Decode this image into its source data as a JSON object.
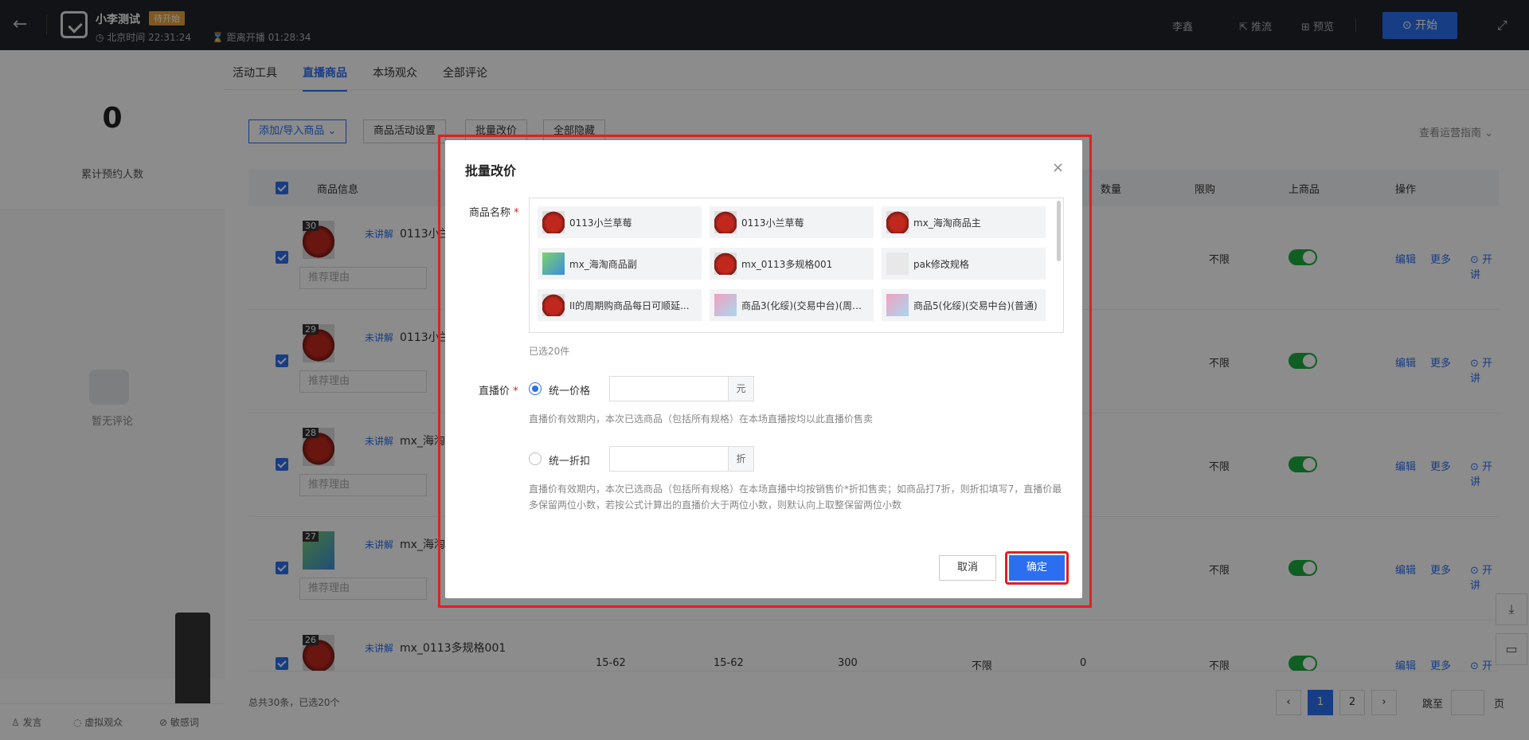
{
  "header": {
    "title": "小李测试",
    "status": "待开始",
    "beijing_time": "北京时间 22:31:24",
    "countdown": "距离开播 01:28:34",
    "user": "李鑫",
    "push_label": "推流",
    "preview_label": "预览",
    "start_label": "开始"
  },
  "left": {
    "reserve_count": "0",
    "reserve_label": "累计预约人数",
    "no_comment": "暂无评论",
    "footer": [
      "发言",
      "虚拟观众",
      "敏感词"
    ]
  },
  "tabs": [
    "活动工具",
    "直播商品",
    "本场观众",
    "全部评论"
  ],
  "toolbar": {
    "add_import": "添加/导入商品 ⌄",
    "activity_settings": "商品活动设置",
    "batch_price": "批量改价",
    "hide_all": "全部隐藏",
    "guide": "查看运营指南 ⌄"
  },
  "table": {
    "headers": {
      "info": "商品信息",
      "sold": "数量",
      "limit": "限购",
      "onsale": "上商品",
      "ops": "操作"
    },
    "rows": [
      {
        "rank": "30",
        "status": "未讲解",
        "name": "0113小兰",
        "reason_placeholder": "推荐理由",
        "limit": "不限"
      },
      {
        "rank": "29",
        "status": "未讲解",
        "name": "0113小兰",
        "reason_placeholder": "推荐理由",
        "limit": "不限"
      },
      {
        "rank": "28",
        "status": "未讲解",
        "name": "mx_海淘",
        "reason_placeholder": "推荐理由",
        "limit": "不限"
      },
      {
        "rank": "27",
        "status": "未讲解",
        "name": "mx_海淘",
        "reason_placeholder": "推荐理由",
        "limit": "不限"
      },
      {
        "rank": "26",
        "status": "未讲解",
        "name": "mx_0113多规格001",
        "reason_placeholder": "",
        "limit": "不限"
      }
    ],
    "last_row_values": [
      "15-62",
      "15-62",
      "300",
      "不限",
      "0"
    ],
    "ops": {
      "edit": "编辑",
      "more": "更多",
      "explain": "开讲"
    }
  },
  "pager": {
    "summary": "总共30条，已选20个",
    "pages": [
      "1",
      "2"
    ],
    "jump_label": "跳至",
    "jump_unit": "页"
  },
  "dialog": {
    "title": "批量改价",
    "close": "×",
    "product_label": "商品名称",
    "products": [
      "0113小兰草莓",
      "0113小兰草莓",
      "mx_海淘商品主",
      "mx_海淘商品副",
      "mx_0113多规格001",
      "pak修改规格",
      "II的周期购商品每日可顺延...",
      "商品3(化绥)(交易中台)(周期...",
      "商品5(化绥)(交易中台)(普通)"
    ],
    "selected_count": "已选20件",
    "price_label": "直播价",
    "opt_unified_price": "统一价格",
    "unit_yuan": "元",
    "hint_price": "直播价有效期内，本次已选商品（包括所有规格）在本场直播按均以此直播价售卖",
    "opt_unified_discount": "统一折扣",
    "unit_discount": "折",
    "hint_discount": "直播价有效期内，本次已选商品（包括所有规格）在本场直播中均按销售价*折扣售卖；如商品打7折，则折扣填写7，直播价最多保留两位小数，若按公式计算出的直播价大于两位小数，则默认向上取整保留两位小数",
    "cancel": "取消",
    "confirm": "确定"
  }
}
